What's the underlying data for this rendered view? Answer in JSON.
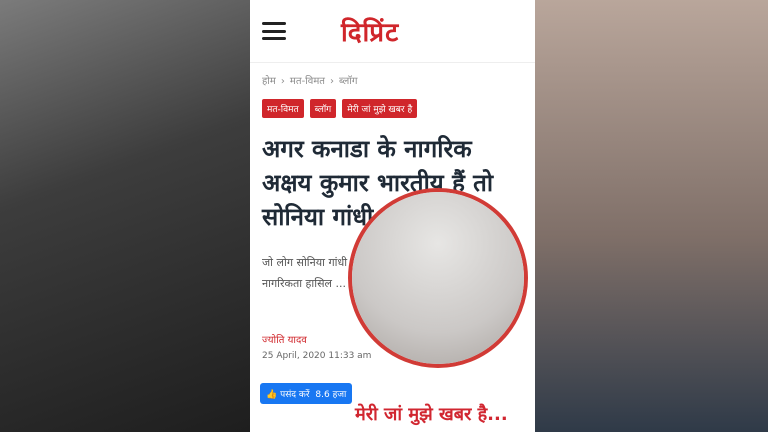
{
  "article": {
    "brand": "दिप्रिंट",
    "breadcrumbs": [
      "होम",
      "मत-विमत",
      "ब्लॉग"
    ],
    "tags": [
      "मत-विमत",
      "ब्लॉग",
      "मेरी जां मुझे खबर है"
    ],
    "headline": "अगर कनाडा के नागरिक अक्षय कुमार भारतीय हैं तो सोनिया गांधी क्यों नहीं",
    "excerpt": "जो लोग सोनिया गांधी ... देश में पै होने की वजह से ... देशी नागरिकता हासिल ... महसूस करते हैं.",
    "author": "ज्योति यादव",
    "date": "25 April, 2020 11:33 am",
    "like_label": "पसंद करें",
    "like_count": "8.6 हजा"
  },
  "overlay": {
    "blog_title": "मेरी जां मुझे खबर है..."
  },
  "colors": {
    "brand": "#d0262b",
    "like_button": "#1877f2"
  },
  "icons": {
    "menu": "hamburger-icon",
    "like": "thumbs-up-icon"
  }
}
